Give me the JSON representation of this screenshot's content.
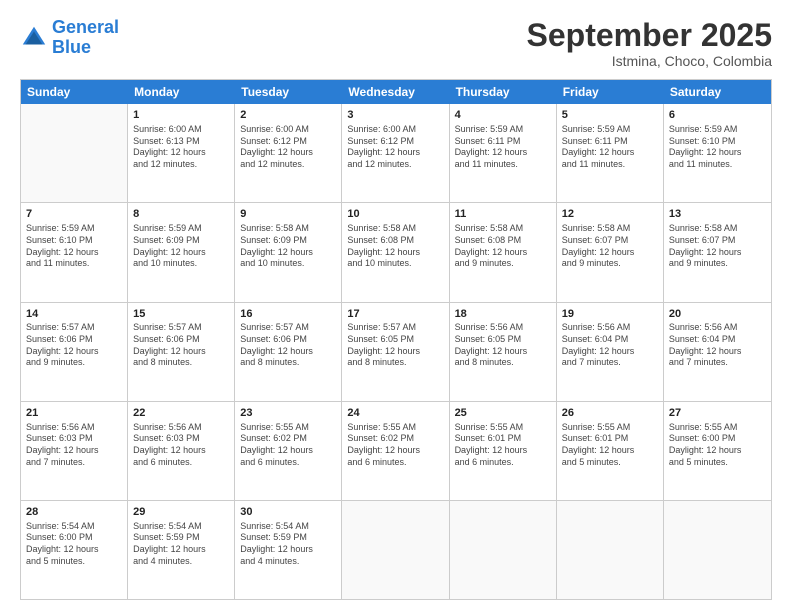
{
  "logo": {
    "line1": "General",
    "line2": "Blue"
  },
  "title": "September 2025",
  "subtitle": "Istmina, Choco, Colombia",
  "header_days": [
    "Sunday",
    "Monday",
    "Tuesday",
    "Wednesday",
    "Thursday",
    "Friday",
    "Saturday"
  ],
  "weeks": [
    [
      {
        "day": "",
        "info": ""
      },
      {
        "day": "1",
        "info": "Sunrise: 6:00 AM\nSunset: 6:13 PM\nDaylight: 12 hours\nand 12 minutes."
      },
      {
        "day": "2",
        "info": "Sunrise: 6:00 AM\nSunset: 6:12 PM\nDaylight: 12 hours\nand 12 minutes."
      },
      {
        "day": "3",
        "info": "Sunrise: 6:00 AM\nSunset: 6:12 PM\nDaylight: 12 hours\nand 12 minutes."
      },
      {
        "day": "4",
        "info": "Sunrise: 5:59 AM\nSunset: 6:11 PM\nDaylight: 12 hours\nand 11 minutes."
      },
      {
        "day": "5",
        "info": "Sunrise: 5:59 AM\nSunset: 6:11 PM\nDaylight: 12 hours\nand 11 minutes."
      },
      {
        "day": "6",
        "info": "Sunrise: 5:59 AM\nSunset: 6:10 PM\nDaylight: 12 hours\nand 11 minutes."
      }
    ],
    [
      {
        "day": "7",
        "info": "Sunrise: 5:59 AM\nSunset: 6:10 PM\nDaylight: 12 hours\nand 11 minutes."
      },
      {
        "day": "8",
        "info": "Sunrise: 5:59 AM\nSunset: 6:09 PM\nDaylight: 12 hours\nand 10 minutes."
      },
      {
        "day": "9",
        "info": "Sunrise: 5:58 AM\nSunset: 6:09 PM\nDaylight: 12 hours\nand 10 minutes."
      },
      {
        "day": "10",
        "info": "Sunrise: 5:58 AM\nSunset: 6:08 PM\nDaylight: 12 hours\nand 10 minutes."
      },
      {
        "day": "11",
        "info": "Sunrise: 5:58 AM\nSunset: 6:08 PM\nDaylight: 12 hours\nand 9 minutes."
      },
      {
        "day": "12",
        "info": "Sunrise: 5:58 AM\nSunset: 6:07 PM\nDaylight: 12 hours\nand 9 minutes."
      },
      {
        "day": "13",
        "info": "Sunrise: 5:58 AM\nSunset: 6:07 PM\nDaylight: 12 hours\nand 9 minutes."
      }
    ],
    [
      {
        "day": "14",
        "info": "Sunrise: 5:57 AM\nSunset: 6:06 PM\nDaylight: 12 hours\nand 9 minutes."
      },
      {
        "day": "15",
        "info": "Sunrise: 5:57 AM\nSunset: 6:06 PM\nDaylight: 12 hours\nand 8 minutes."
      },
      {
        "day": "16",
        "info": "Sunrise: 5:57 AM\nSunset: 6:06 PM\nDaylight: 12 hours\nand 8 minutes."
      },
      {
        "day": "17",
        "info": "Sunrise: 5:57 AM\nSunset: 6:05 PM\nDaylight: 12 hours\nand 8 minutes."
      },
      {
        "day": "18",
        "info": "Sunrise: 5:56 AM\nSunset: 6:05 PM\nDaylight: 12 hours\nand 8 minutes."
      },
      {
        "day": "19",
        "info": "Sunrise: 5:56 AM\nSunset: 6:04 PM\nDaylight: 12 hours\nand 7 minutes."
      },
      {
        "day": "20",
        "info": "Sunrise: 5:56 AM\nSunset: 6:04 PM\nDaylight: 12 hours\nand 7 minutes."
      }
    ],
    [
      {
        "day": "21",
        "info": "Sunrise: 5:56 AM\nSunset: 6:03 PM\nDaylight: 12 hours\nand 7 minutes."
      },
      {
        "day": "22",
        "info": "Sunrise: 5:56 AM\nSunset: 6:03 PM\nDaylight: 12 hours\nand 6 minutes."
      },
      {
        "day": "23",
        "info": "Sunrise: 5:55 AM\nSunset: 6:02 PM\nDaylight: 12 hours\nand 6 minutes."
      },
      {
        "day": "24",
        "info": "Sunrise: 5:55 AM\nSunset: 6:02 PM\nDaylight: 12 hours\nand 6 minutes."
      },
      {
        "day": "25",
        "info": "Sunrise: 5:55 AM\nSunset: 6:01 PM\nDaylight: 12 hours\nand 6 minutes."
      },
      {
        "day": "26",
        "info": "Sunrise: 5:55 AM\nSunset: 6:01 PM\nDaylight: 12 hours\nand 5 minutes."
      },
      {
        "day": "27",
        "info": "Sunrise: 5:55 AM\nSunset: 6:00 PM\nDaylight: 12 hours\nand 5 minutes."
      }
    ],
    [
      {
        "day": "28",
        "info": "Sunrise: 5:54 AM\nSunset: 6:00 PM\nDaylight: 12 hours\nand 5 minutes."
      },
      {
        "day": "29",
        "info": "Sunrise: 5:54 AM\nSunset: 5:59 PM\nDaylight: 12 hours\nand 4 minutes."
      },
      {
        "day": "30",
        "info": "Sunrise: 5:54 AM\nSunset: 5:59 PM\nDaylight: 12 hours\nand 4 minutes."
      },
      {
        "day": "",
        "info": ""
      },
      {
        "day": "",
        "info": ""
      },
      {
        "day": "",
        "info": ""
      },
      {
        "day": "",
        "info": ""
      }
    ]
  ]
}
